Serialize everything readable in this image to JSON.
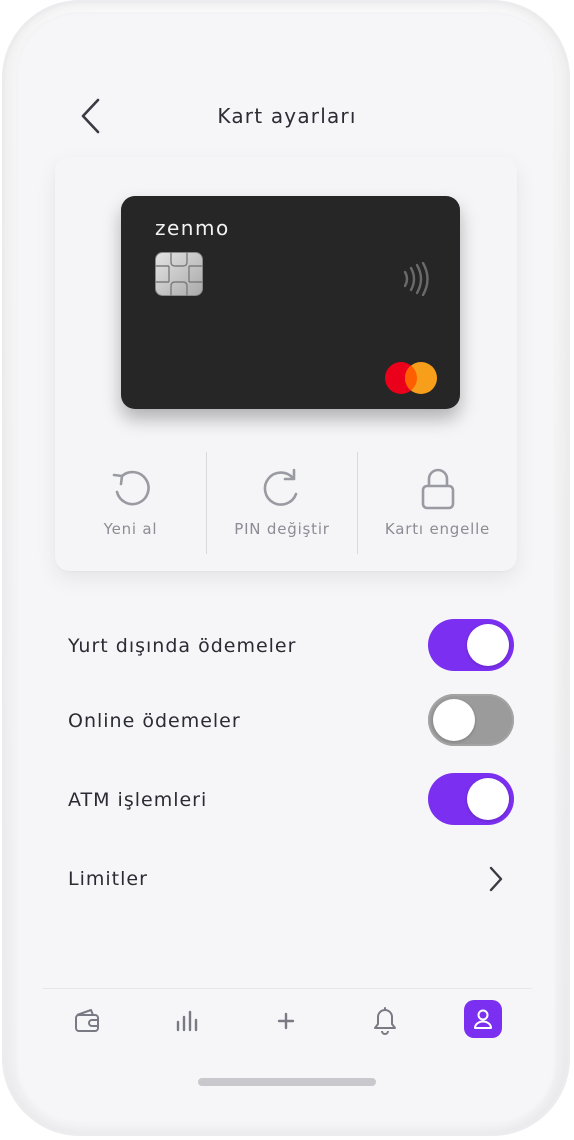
{
  "header": {
    "title": "Kart ayarları",
    "back_icon": "chevron-left-icon"
  },
  "card": {
    "brand": "zenmo",
    "card_color": "#262626",
    "network": "mastercard",
    "network_colors": [
      "#eb001b",
      "#f79e1b"
    ]
  },
  "actions": [
    {
      "label": "Yeni al",
      "icon": "refresh-icon"
    },
    {
      "label": "PIN değiştir",
      "icon": "rotate-icon"
    },
    {
      "label": "Kartı engelle",
      "icon": "lock-icon"
    }
  ],
  "settings": [
    {
      "label": "Yurt dışında ödemeler",
      "enabled": true
    },
    {
      "label": "Online ödemeler",
      "enabled": false
    },
    {
      "label": "ATM işlemleri",
      "enabled": true
    }
  ],
  "limits": {
    "label": "Limitler",
    "icon": "chevron-right-icon"
  },
  "nav": {
    "items": [
      "wallet-icon",
      "stats-icon",
      "plus-icon",
      "bell-icon",
      "profile-icon"
    ],
    "active": "profile-icon"
  },
  "colors": {
    "accent": "#7b2ff0",
    "toggle_off": "#9b9b9b"
  }
}
